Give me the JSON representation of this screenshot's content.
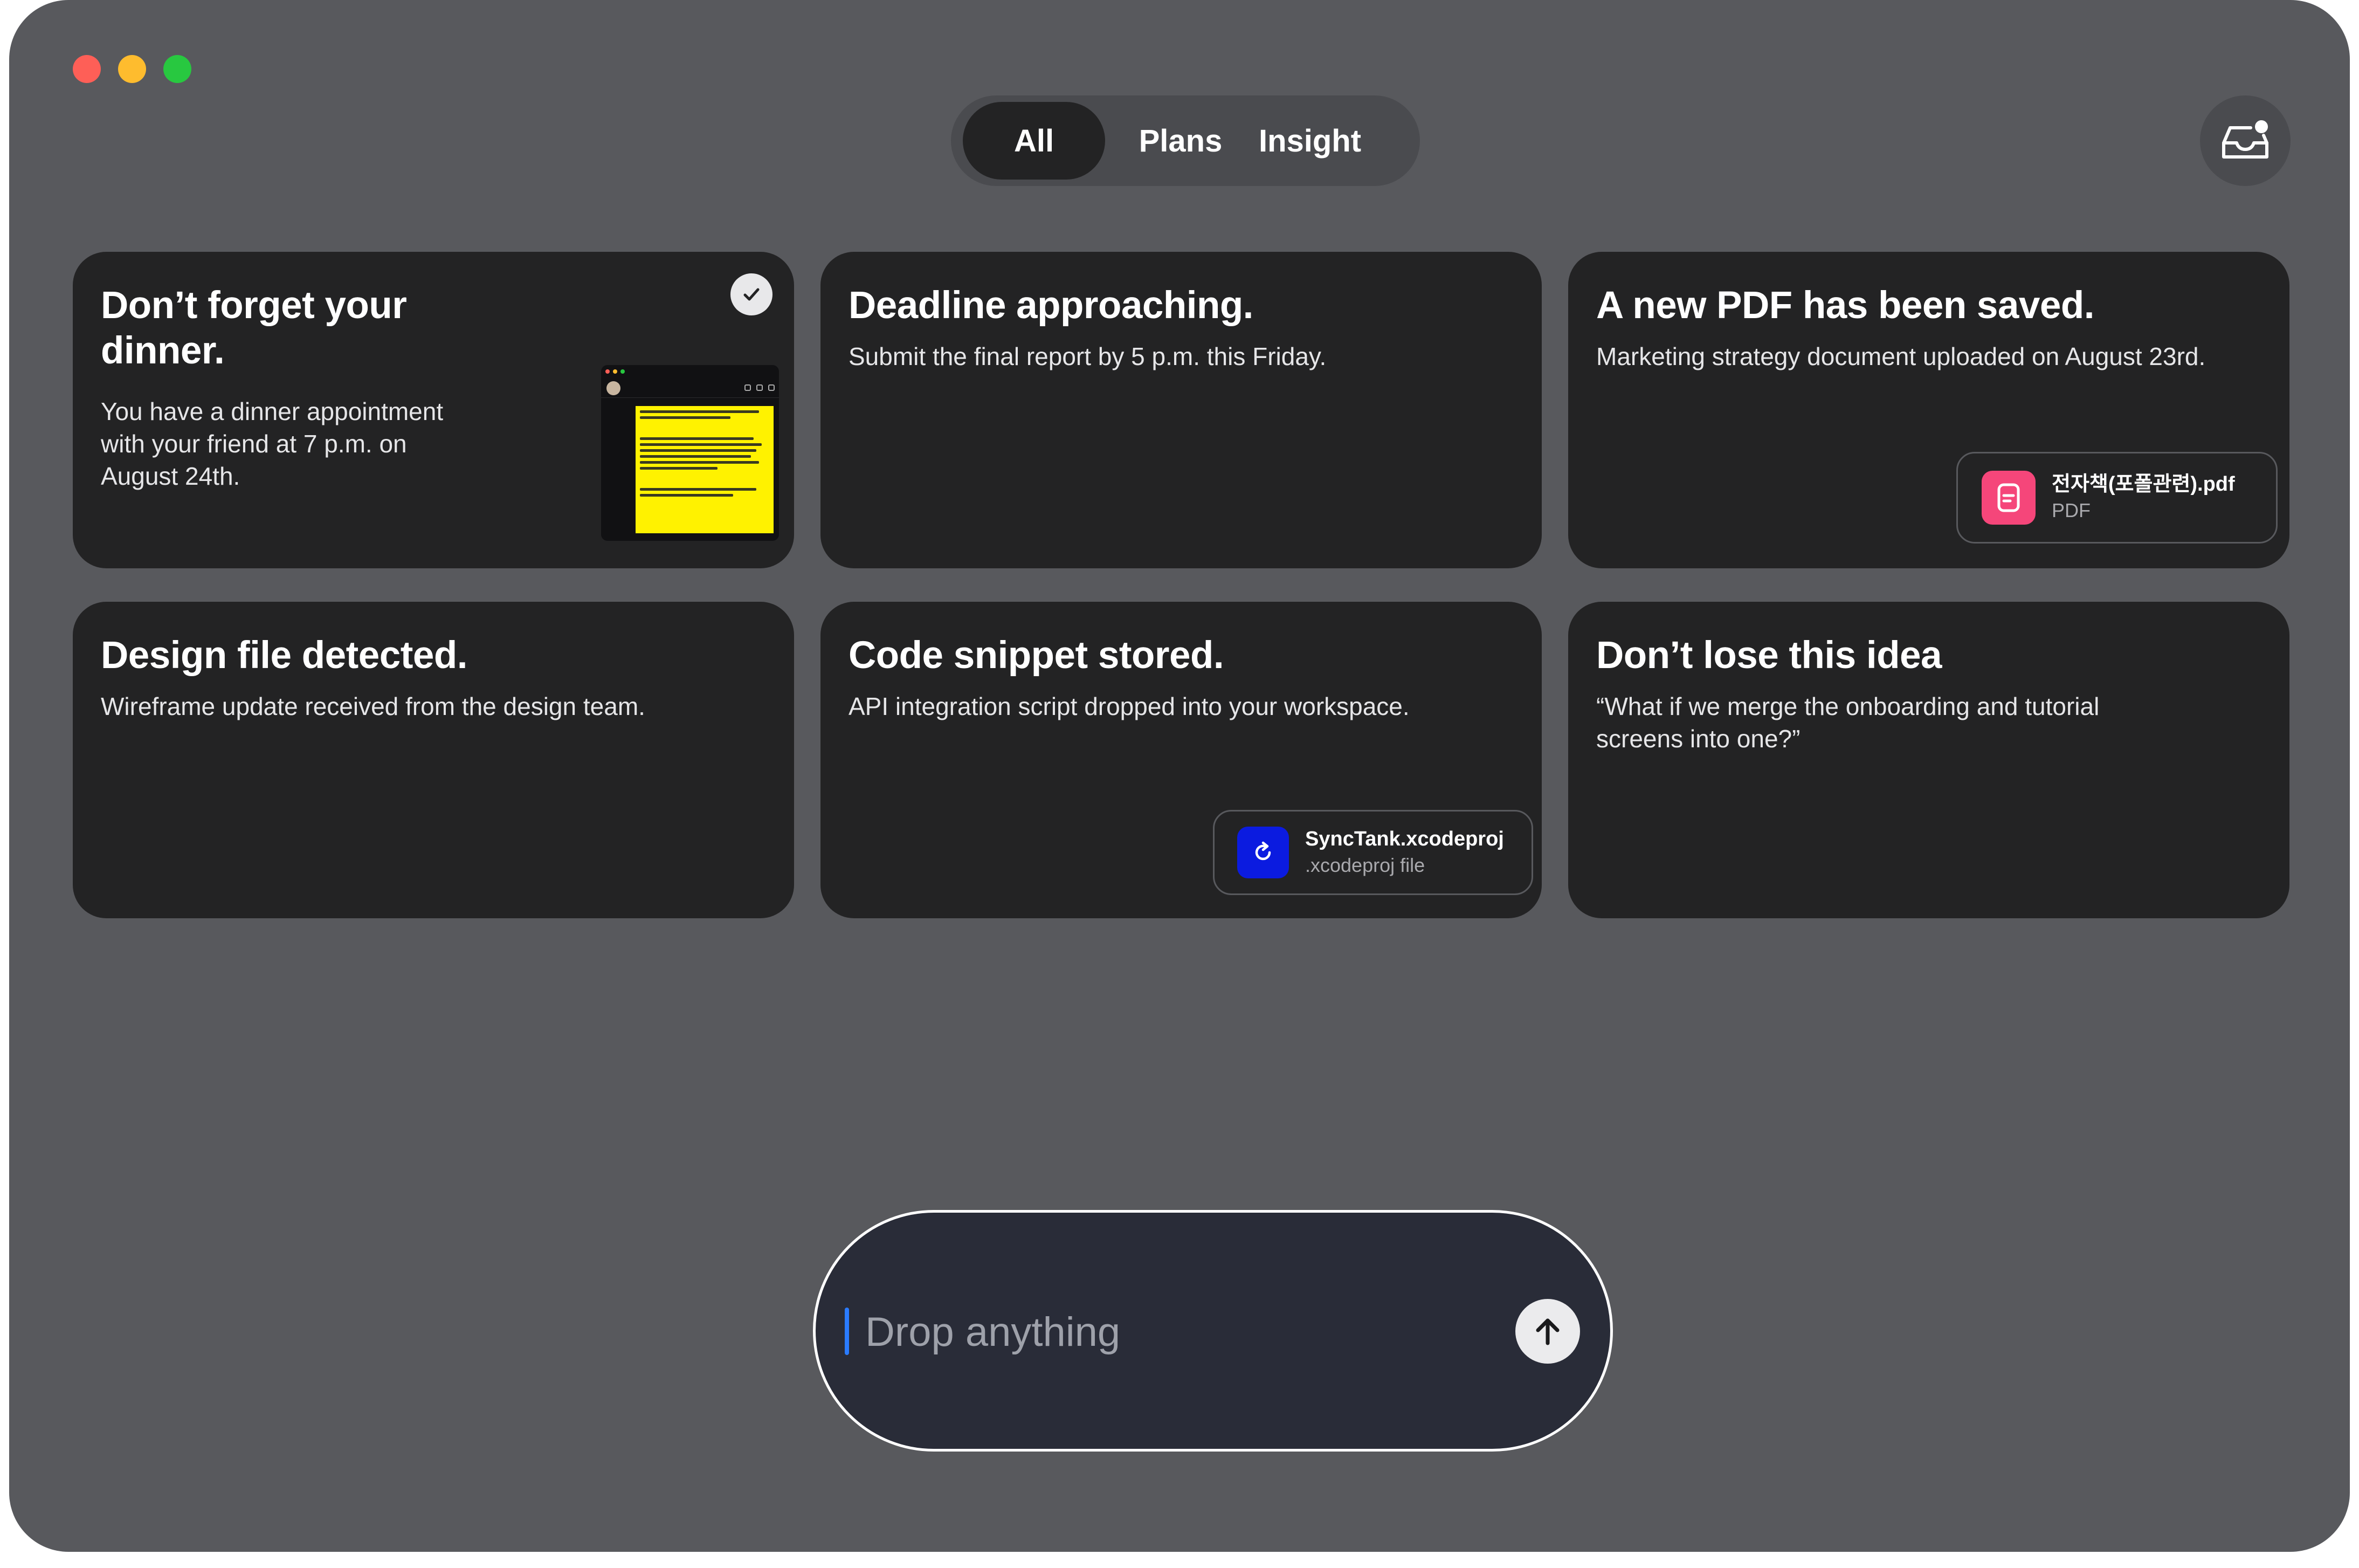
{
  "window": {
    "traffic_lights": [
      "close",
      "minimize",
      "zoom"
    ],
    "colors": {
      "background": "#58595d",
      "card": "#232324",
      "pdf_icon": "#f5467a",
      "xcode_icon": "#0b1be0",
      "cursor": "#2a7bff"
    }
  },
  "tabs": [
    {
      "label": "All",
      "active": true
    },
    {
      "label": "Plans",
      "active": false
    },
    {
      "label": "Insight",
      "active": false
    }
  ],
  "header": {
    "inbox_icon": "inbox-tray-icon"
  },
  "cards": [
    {
      "title": "Don’t forget your dinner.",
      "body": "You have a dinner appointment with your friend at 7 p.m. on August 24th.",
      "checked": true,
      "thumbnail": "chat-screenshot"
    },
    {
      "title": "Deadline approaching.",
      "body": "Submit the final report by 5 p.m. this Friday."
    },
    {
      "title": "A new PDF has been saved.",
      "body": "Marketing strategy document uploaded on August 23rd.",
      "file": {
        "name": "전자책(포폴관련).pdf",
        "type": "PDF",
        "icon": "document-icon"
      }
    },
    {
      "title": "Design file detected.",
      "body": "Wireframe update received from the design team."
    },
    {
      "title": "Code snippet stored.",
      "body": "API integration script dropped into your workspace.",
      "file": {
        "name": "SyncTank.xcodeproj",
        "type": ".xcodeproj file",
        "icon": "refresh-icon"
      }
    },
    {
      "title": "Don’t lose this idea",
      "body": "“What if we merge the onboarding and tutorial screens into one?”"
    }
  ],
  "composer": {
    "placeholder": "Drop anything",
    "send_icon": "arrow-up-icon"
  }
}
